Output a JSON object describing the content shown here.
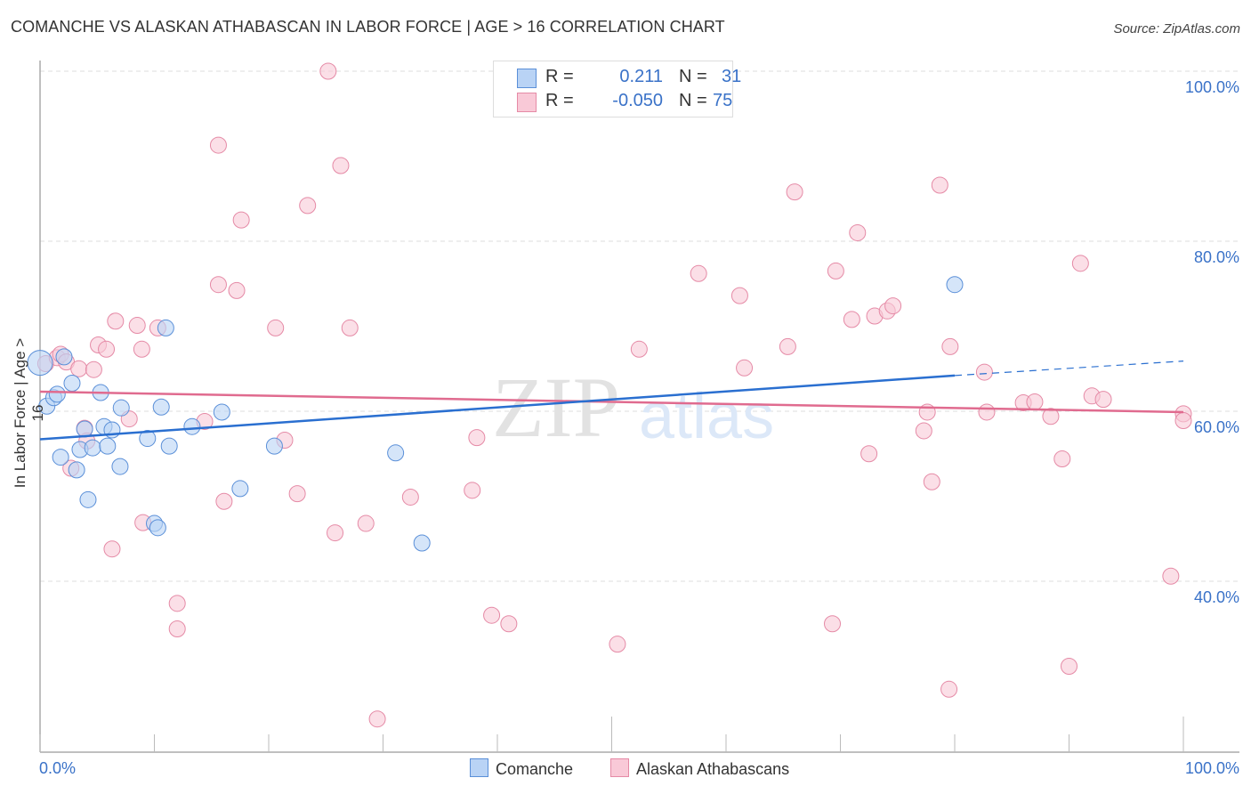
{
  "header": {
    "title": "COMANCHE VS ALASKAN ATHABASCAN IN LABOR FORCE | AGE > 16 CORRELATION CHART",
    "source": "Source: ZipAtlas.com"
  },
  "colors": {
    "comanche_fill": "#b9d3f5",
    "comanche_stroke": "#5a8fd8",
    "comanche_line": "#2a6fd0",
    "athabascan_fill": "#f9c9d7",
    "athabascan_stroke": "#e58aa6",
    "athabascan_line": "#e06b8f",
    "axis_text": "#3a72c8"
  },
  "stats_legend": {
    "rows": [
      {
        "r_label": "R =",
        "r_value": "0.211",
        "n_label": "N =",
        "n_value": "31"
      },
      {
        "r_label": "R =",
        "r_value": "-0.050",
        "n_label": "N =",
        "n_value": "75"
      }
    ]
  },
  "bottom_legend": {
    "items": [
      "Comanche",
      "Alaskan Athabascans"
    ]
  },
  "watermark": {
    "part1": "ZIP",
    "part2": "atlas"
  },
  "chart_data": {
    "type": "scatter",
    "title": "COMANCHE VS ALASKAN ATHABASCAN IN LABOR FORCE | AGE > 16 CORRELATION CHART",
    "xlabel": "",
    "ylabel": "In Labor Force | Age > 16",
    "xlim": [
      0,
      100
    ],
    "ylim": [
      23.6,
      101.5
    ],
    "x_tick_labels": [
      "0.0%",
      "100.0%"
    ],
    "x_minor_ticks": [
      0,
      10,
      20,
      30,
      40,
      50,
      60,
      70,
      80,
      90,
      100
    ],
    "y_ticks": [
      100,
      80,
      60,
      40
    ],
    "y_tick_labels": [
      "100.0%",
      "80.0%",
      "60.0%",
      "40.0%"
    ],
    "grid": true,
    "legend_position": "top-center",
    "series": [
      {
        "name": "Comanche",
        "R": 0.211,
        "N": 31,
        "trend": {
          "x0": 0,
          "y0": 56.7,
          "x1": 80,
          "y1": 64.2,
          "dash_to_x": 100,
          "dash_to_y": 65.9
        },
        "points": [
          [
            0,
            65.7
          ],
          [
            0.6,
            60.6
          ],
          [
            1.2,
            61.6
          ],
          [
            1.5,
            62.0
          ],
          [
            1.8,
            54.6
          ],
          [
            2.1,
            66.4
          ],
          [
            2.8,
            63.3
          ],
          [
            3.2,
            53.1
          ],
          [
            3.5,
            55.5
          ],
          [
            3.9,
            57.9
          ],
          [
            4.2,
            49.6
          ],
          [
            4.6,
            55.7
          ],
          [
            5.3,
            62.2
          ],
          [
            5.6,
            58.2
          ],
          [
            5.9,
            55.9
          ],
          [
            6.3,
            57.8
          ],
          [
            7.0,
            53.5
          ],
          [
            7.1,
            60.4
          ],
          [
            9.4,
            56.8
          ],
          [
            10.0,
            46.8
          ],
          [
            10.3,
            46.3
          ],
          [
            10.6,
            60.5
          ],
          [
            11.0,
            69.8
          ],
          [
            11.3,
            55.9
          ],
          [
            13.3,
            58.2
          ],
          [
            15.9,
            59.9
          ],
          [
            17.5,
            50.9
          ],
          [
            20.5,
            55.9
          ],
          [
            31.1,
            55.1
          ],
          [
            33.4,
            44.5
          ],
          [
            80.0,
            74.9
          ]
        ]
      },
      {
        "name": "Alaskan Athabascans",
        "R": -0.05,
        "N": 75,
        "trend": {
          "x0": 0,
          "y0": 62.3,
          "x1": 100,
          "y1": 59.9
        },
        "points": [
          [
            0.5,
            65.6
          ],
          [
            1.5,
            66.3
          ],
          [
            1.8,
            66.7
          ],
          [
            2.3,
            65.8
          ],
          [
            2.7,
            53.3
          ],
          [
            3.4,
            65.0
          ],
          [
            3.9,
            58.0
          ],
          [
            4.1,
            56.5
          ],
          [
            4.7,
            64.9
          ],
          [
            5.1,
            67.8
          ],
          [
            5.8,
            67.3
          ],
          [
            6.3,
            43.8
          ],
          [
            6.6,
            70.6
          ],
          [
            7.8,
            59.1
          ],
          [
            8.5,
            70.1
          ],
          [
            8.9,
            67.3
          ],
          [
            9.0,
            46.9
          ],
          [
            10.3,
            69.8
          ],
          [
            12.0,
            37.4
          ],
          [
            12.0,
            34.4
          ],
          [
            14.4,
            58.8
          ],
          [
            15.6,
            74.9
          ],
          [
            15.6,
            91.3
          ],
          [
            16.1,
            49.4
          ],
          [
            17.2,
            74.2
          ],
          [
            17.6,
            82.5
          ],
          [
            20.6,
            69.8
          ],
          [
            21.4,
            56.6
          ],
          [
            22.5,
            50.3
          ],
          [
            23.4,
            84.2
          ],
          [
            25.2,
            100.0
          ],
          [
            25.8,
            45.7
          ],
          [
            26.3,
            88.9
          ],
          [
            27.1,
            69.8
          ],
          [
            28.5,
            46.8
          ],
          [
            29.5,
            23.8
          ],
          [
            32.4,
            49.9
          ],
          [
            37.8,
            50.7
          ],
          [
            38.2,
            56.9
          ],
          [
            39.5,
            36.0
          ],
          [
            41.0,
            35.0
          ],
          [
            50.5,
            32.6
          ],
          [
            52.4,
            67.3
          ],
          [
            57.6,
            76.2
          ],
          [
            61.2,
            73.6
          ],
          [
            61.6,
            65.1
          ],
          [
            65.4,
            67.6
          ],
          [
            66.0,
            85.8
          ],
          [
            69.3,
            35.0
          ],
          [
            69.6,
            76.5
          ],
          [
            71.0,
            70.8
          ],
          [
            71.5,
            81.0
          ],
          [
            72.5,
            55.0
          ],
          [
            73.0,
            71.2
          ],
          [
            74.1,
            71.8
          ],
          [
            74.6,
            72.4
          ],
          [
            77.3,
            57.7
          ],
          [
            77.6,
            59.9
          ],
          [
            78.0,
            51.7
          ],
          [
            78.7,
            86.6
          ],
          [
            79.5,
            27.3
          ],
          [
            79.6,
            67.6
          ],
          [
            82.6,
            64.6
          ],
          [
            82.8,
            59.9
          ],
          [
            86.0,
            61.0
          ],
          [
            87.0,
            61.1
          ],
          [
            88.4,
            59.4
          ],
          [
            89.4,
            54.4
          ],
          [
            90.0,
            30.0
          ],
          [
            91.0,
            77.4
          ],
          [
            92.0,
            61.8
          ],
          [
            93.0,
            61.4
          ],
          [
            98.9,
            40.6
          ],
          [
            100.0,
            59.7
          ],
          [
            100.0,
            58.9
          ]
        ]
      }
    ]
  }
}
